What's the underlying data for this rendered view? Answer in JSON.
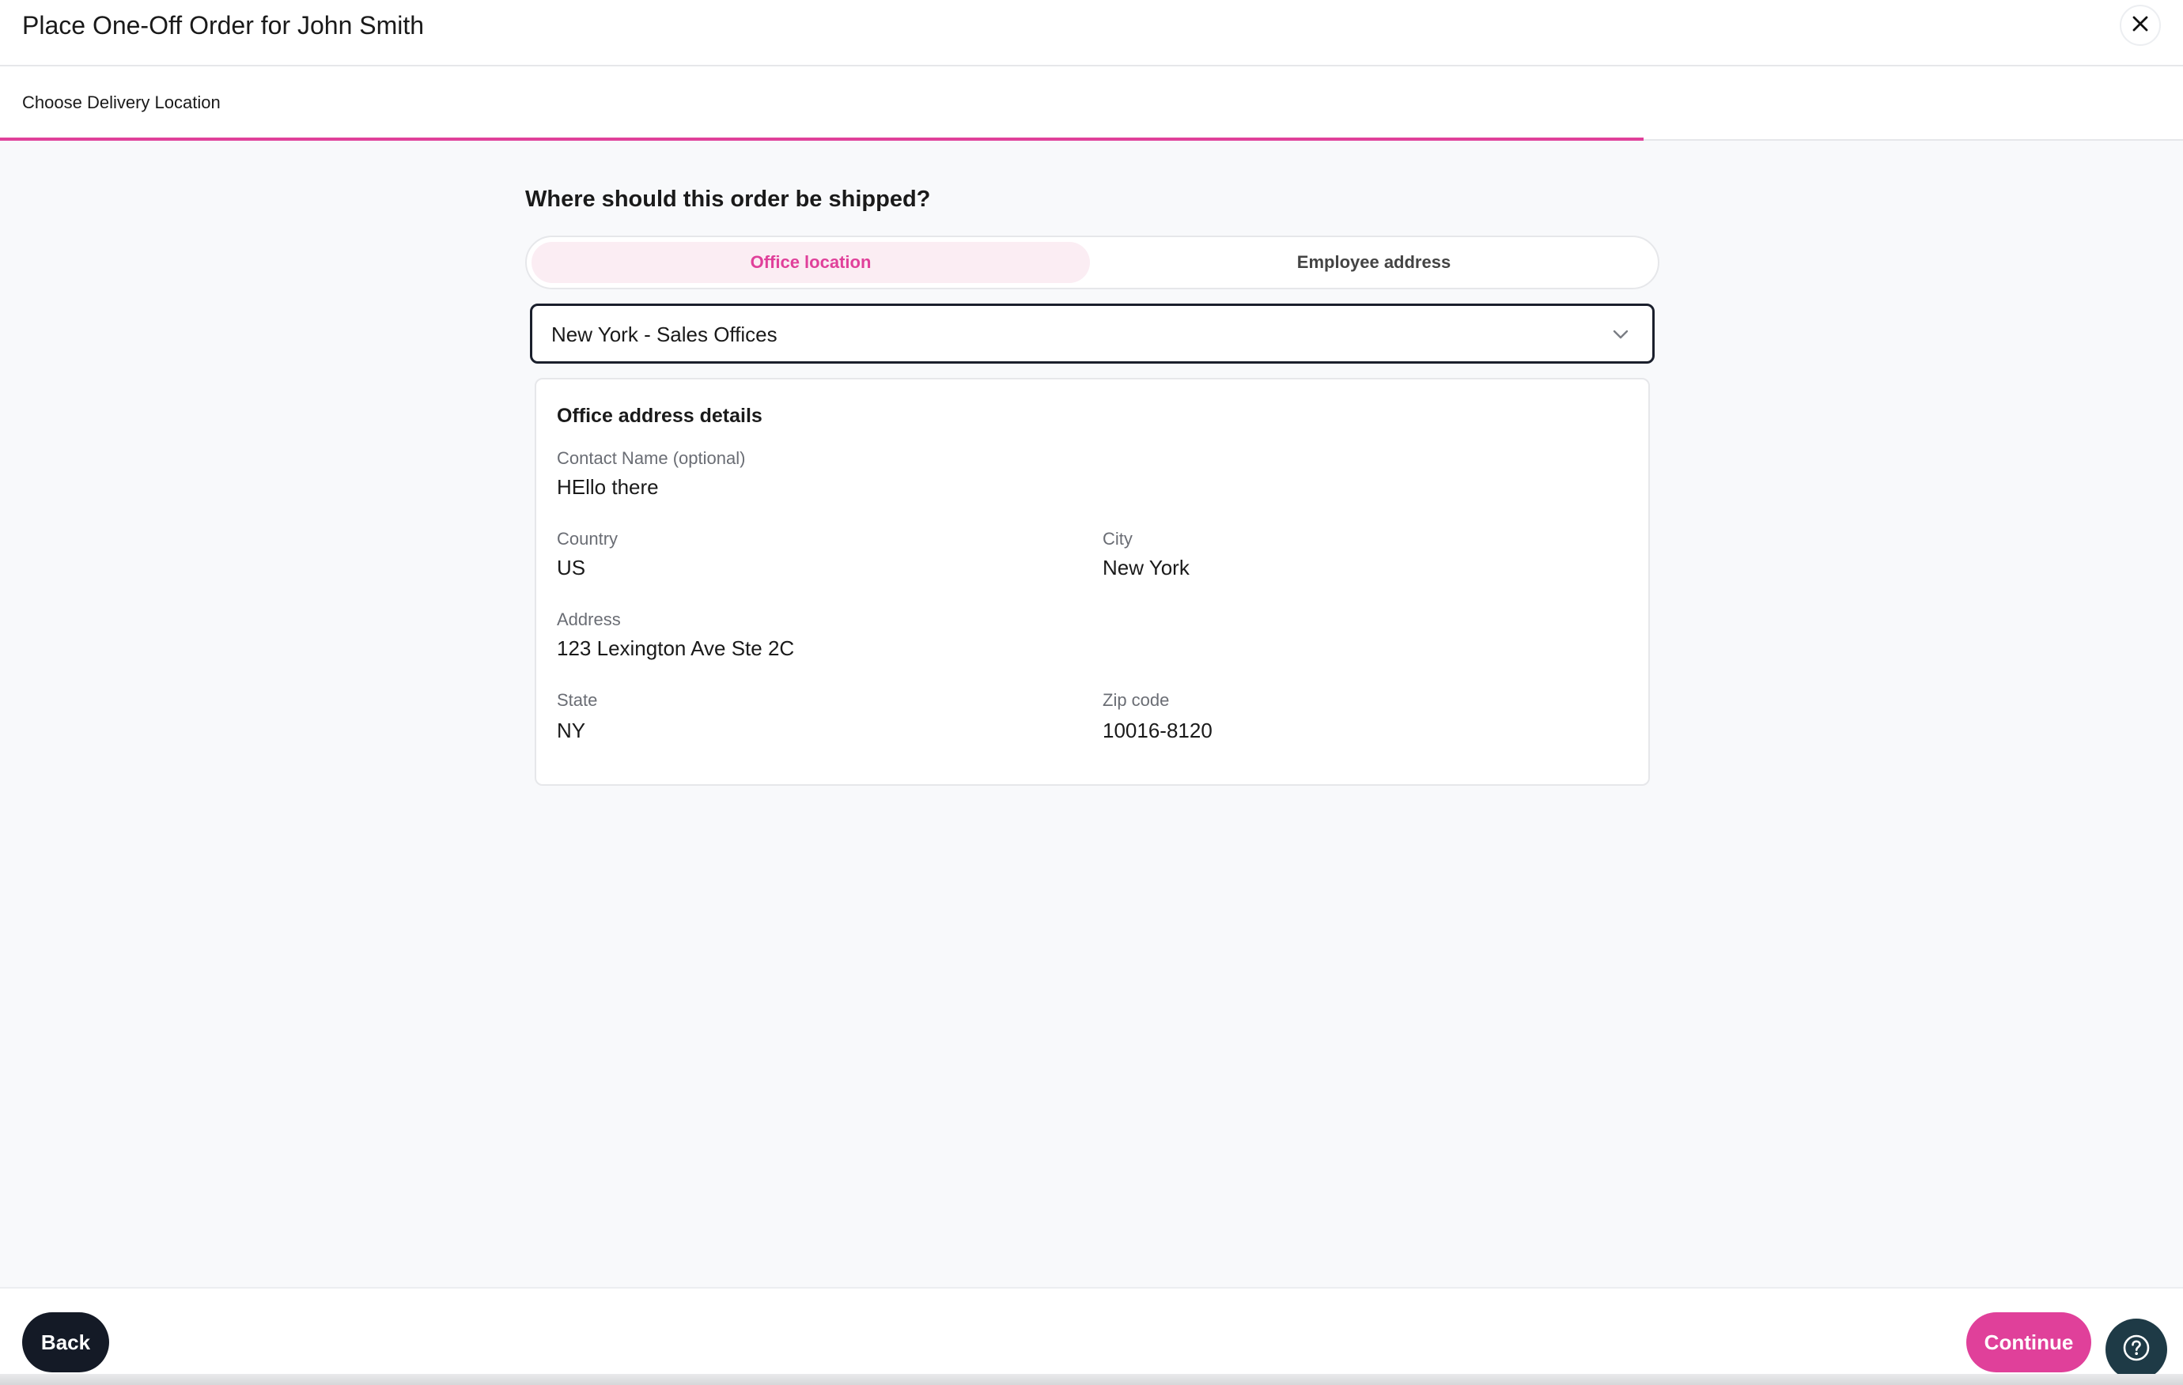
{
  "header": {
    "title": "Place One-Off Order for John Smith",
    "close_icon": "close-icon"
  },
  "stepper": {
    "current_step_label": "Choose Delivery Location",
    "progress_percent": 75.3,
    "accent_color": "#e0409a"
  },
  "main": {
    "question": "Where should this order be shipped?",
    "toggle": {
      "options": [
        "Office location",
        "Employee address"
      ],
      "selected": "Office location"
    },
    "location_select": {
      "value": "New York - Sales Offices",
      "icon": "chevron-down-icon"
    },
    "address_card": {
      "title": "Office address details",
      "contact_name_label": "Contact Name (optional)",
      "contact_name_value": "HEllo there",
      "country_label": "Country",
      "country_value": "US",
      "city_label": "City",
      "city_value": "New York",
      "address_label": "Address",
      "address_value": "123 Lexington Ave Ste 2C",
      "state_label": "State",
      "state_value": "NY",
      "zip_label": "Zip code",
      "zip_value": "10016-8120"
    }
  },
  "footer": {
    "back_label": "Back",
    "continue_label": "Continue",
    "help_icon": "help-icon"
  }
}
